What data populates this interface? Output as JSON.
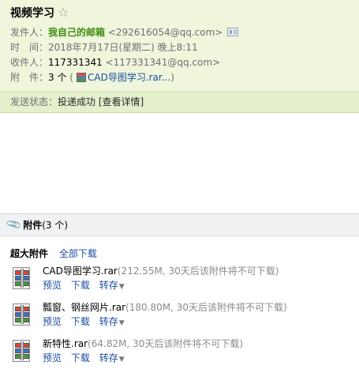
{
  "email": {
    "subject": "视频学习",
    "star_glyph": "☆",
    "sender": {
      "label": "发件人：",
      "name": "我自己的邮箱",
      "address": "<292616054@qq.com>"
    },
    "time": {
      "label": "时　间：",
      "value": "2018年7月17日(星期二) 晚上8:11"
    },
    "recipient": {
      "label": "收件人：",
      "name": "117331341",
      "address": "<117331341@qq.com>"
    },
    "attachments_summary": {
      "label": "附　件：",
      "count": "3 个",
      "open_paren": "(",
      "first_name": "CAD导图学习.rar...",
      "close_paren": ")"
    },
    "send_status": {
      "label": "发送状态：",
      "value": "投递成功",
      "details_link": "[查看详情]"
    }
  },
  "attachments": {
    "title": "附件",
    "count": "(3 个)",
    "section_label": "超大附件",
    "download_all": "全部下载",
    "actions": {
      "preview": "预览",
      "download": "下载",
      "forward": "转存"
    },
    "files": [
      {
        "name": "CAD导图学习.rar",
        "meta": "(212.55M, 30天后该附件将不可下载)"
      },
      {
        "name": "瓢窗、钢丝网片.rar",
        "meta": "(180.80M, 30天后该附件将不可下载)"
      },
      {
        "name": "新特性.rar",
        "meta": "(64.82M, 30天后该附件将不可下载)"
      }
    ]
  },
  "icons": {
    "star": "star-outline-icon",
    "contact_card": "contact-card-icon",
    "paperclip": "paperclip-icon",
    "archive": "rar-archive-icon",
    "caret": "caret-down-icon"
  },
  "colors": {
    "header_bg": "#eff6dc",
    "status_bg": "#e4efcb",
    "sender_green": "#3f8b12",
    "link_blue": "#1c4ea2",
    "attach_header_bg": "#eff1f3"
  }
}
